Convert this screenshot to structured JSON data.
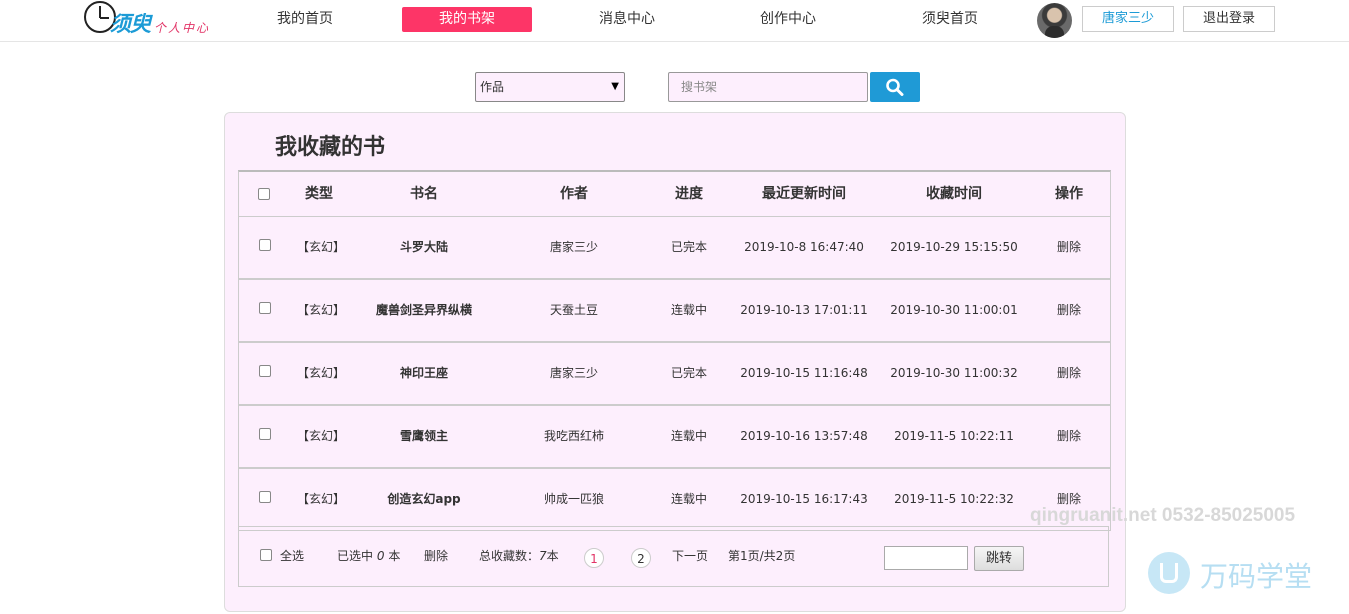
{
  "logo": {
    "main": "须臾",
    "sub": "个人中心"
  },
  "nav": [
    {
      "label": "我的首页",
      "active": false
    },
    {
      "label": "我的书架",
      "active": true
    },
    {
      "label": "消息中心",
      "active": false
    },
    {
      "label": "创作中心",
      "active": false
    },
    {
      "label": "须臾首页",
      "active": false
    }
  ],
  "user": {
    "name": "唐家三少",
    "logout_label": "退出登录"
  },
  "search": {
    "category": "作品",
    "placeholder": "搜书架"
  },
  "panel": {
    "title": "我收藏的书"
  },
  "table": {
    "headers": [
      "类型",
      "书名",
      "作者",
      "进度",
      "最近更新时间",
      "收藏时间",
      "操作"
    ],
    "rows": [
      {
        "type": "【玄幻】",
        "title": "斗罗大陆",
        "author": "唐家三少",
        "progress": "已完本",
        "updated": "2019-10-8 16:47:40",
        "collected": "2019-10-29 15:15:50",
        "action": "删除"
      },
      {
        "type": "【玄幻】",
        "title": "魔兽剑圣异界纵横",
        "author": "天蚕土豆",
        "progress": "连载中",
        "updated": "2019-10-13 17:01:11",
        "collected": "2019-10-30 11:00:01",
        "action": "删除"
      },
      {
        "type": "【玄幻】",
        "title": "神印王座",
        "author": "唐家三少",
        "progress": "已完本",
        "updated": "2019-10-15 11:16:48",
        "collected": "2019-10-30 11:00:32",
        "action": "删除"
      },
      {
        "type": "【玄幻】",
        "title": "雪鹰领主",
        "author": "我吃西红柿",
        "progress": "连载中",
        "updated": "2019-10-16 13:57:48",
        "collected": "2019-11-5 10:22:11",
        "action": "删除"
      },
      {
        "type": "【玄幻】",
        "title": "创造玄幻app",
        "author": "帅成一匹狼",
        "progress": "连载中",
        "updated": "2019-10-15 16:17:43",
        "collected": "2019-11-5 10:22:32",
        "action": "删除"
      }
    ]
  },
  "footer": {
    "select_all": "全选",
    "selected_prefix": "已选中",
    "selected_count": "0",
    "selected_suffix": "本",
    "delete_label": "删除",
    "total_label": "总收藏数：",
    "total_count": "7",
    "total_suffix": "本",
    "pages": [
      "1",
      "2"
    ],
    "next_label": "下一页",
    "page_info": "第1页/共2页",
    "jump_label": "跳转"
  },
  "watermark": {
    "text": "qingruanit.net 0532-85025005",
    "brand": "万码学堂"
  }
}
